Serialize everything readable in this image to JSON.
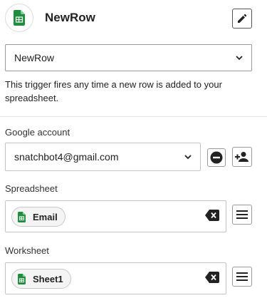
{
  "header": {
    "title": "NewRow",
    "app_icon": "google-sheets-icon",
    "edit_icon": "pencil-icon"
  },
  "trigger": {
    "selected": "NewRow",
    "description": "This trigger fires any time a new row is added to your spreadsheet."
  },
  "google_account": {
    "label": "Google account",
    "selected": "snatchbot4@gmail.com"
  },
  "spreadsheet": {
    "label": "Spreadsheet",
    "chip_label": "Email"
  },
  "worksheet": {
    "label": "Worksheet",
    "chip_label": "Sheet1"
  },
  "colors": {
    "sheets_green": "#1E8E3E",
    "border": "#c4c4c4",
    "text": "#222222"
  }
}
